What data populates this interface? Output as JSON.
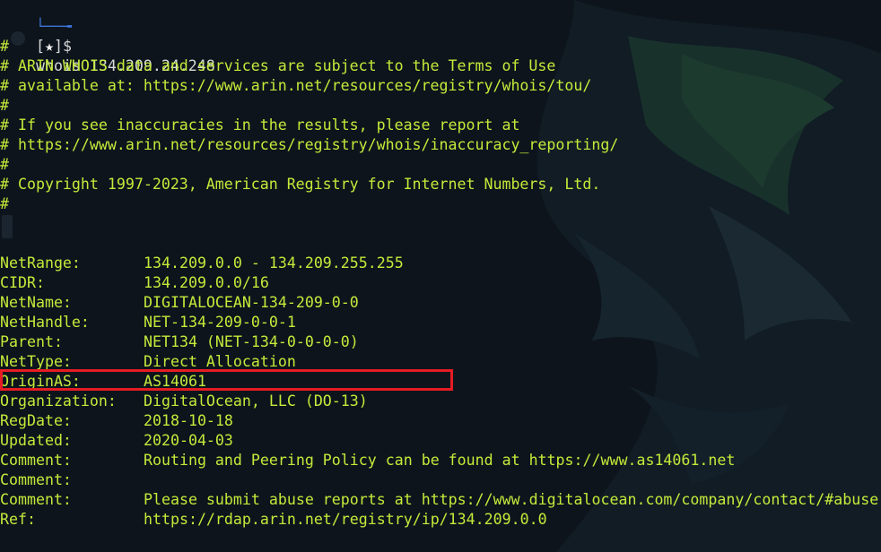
{
  "terminal": {
    "prompt": {
      "connector": "└──╼",
      "open_bracket": "[",
      "star": "★",
      "close_bracket": "]$",
      "command": "whois 134.209.24.248"
    },
    "comments": [
      "#",
      "# ARIN WHOIS data and services are subject to the Terms of Use",
      "# available at: https://www.arin.net/resources/registry/whois/tou/",
      "#",
      "# If you see inaccuracies in the results, please report at",
      "# https://www.arin.net/resources/registry/whois/inaccuracy_reporting/",
      "#",
      "# Copyright 1997-2023, American Registry for Internet Numbers, Ltd.",
      "#"
    ],
    "records": [
      {
        "key": "NetRange:",
        "value": "134.209.0.0 - 134.209.255.255"
      },
      {
        "key": "CIDR:",
        "value": "134.209.0.0/16"
      },
      {
        "key": "NetName:",
        "value": "DIGITALOCEAN-134-209-0-0"
      },
      {
        "key": "NetHandle:",
        "value": "NET-134-209-0-0-1"
      },
      {
        "key": "Parent:",
        "value": "NET134 (NET-134-0-0-0-0)"
      },
      {
        "key": "NetType:",
        "value": "Direct Allocation"
      },
      {
        "key": "OriginAS:",
        "value": "AS14061"
      },
      {
        "key": "Organization:",
        "value": "DigitalOcean, LLC (DO-13)"
      },
      {
        "key": "RegDate:",
        "value": "2018-10-18"
      },
      {
        "key": "Updated:",
        "value": "2020-04-03"
      },
      {
        "key": "Comment:",
        "value": "Routing and Peering Policy can be found at https://www.as14061.net"
      },
      {
        "key": "Comment:",
        "value": ""
      },
      {
        "key": "Comment:",
        "value": "Please submit abuse reports at https://www.digitalocean.com/company/contact/#abuse"
      },
      {
        "key": "Ref:",
        "value": "https://rdap.arin.net/registry/ip/134.209.0.0"
      }
    ]
  },
  "colors": {
    "background": "#0d141c",
    "text": "#c4ea3a",
    "prompt_connector": "#3b74d6",
    "highlight_border": "#e51c23"
  },
  "icons": {
    "wallpaper": "dragon-emblem-icon"
  }
}
